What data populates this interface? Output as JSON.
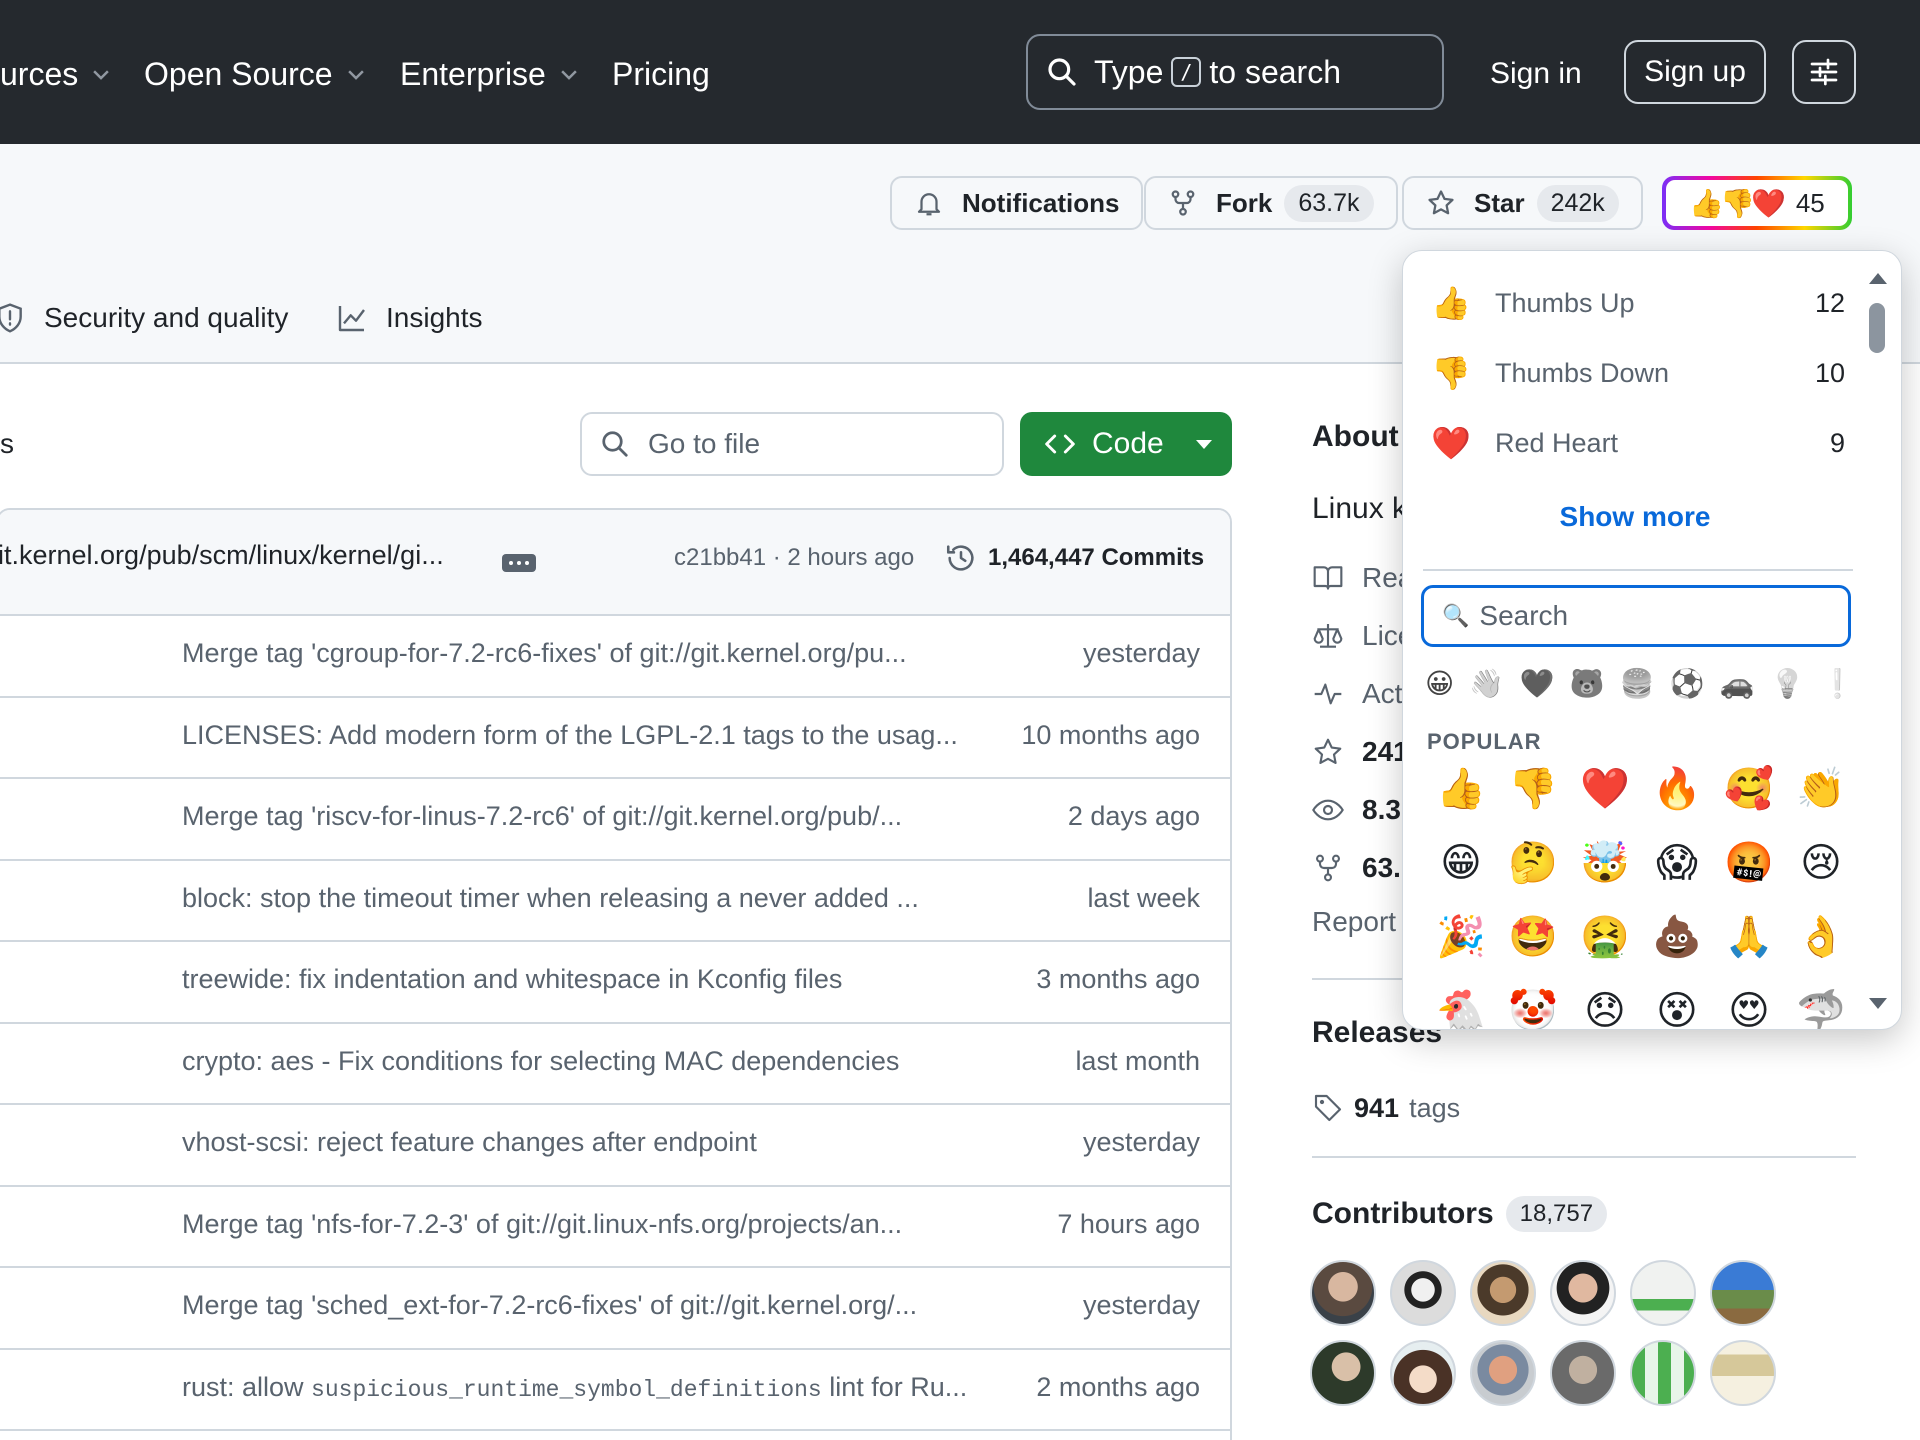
{
  "nav": {
    "items": [
      "urces",
      "Open Source",
      "Enterprise",
      "Pricing"
    ],
    "search_pre": "Type",
    "search_key": "/",
    "search_post": "to search",
    "signin": "Sign in",
    "signup": "Sign up"
  },
  "header": {
    "notifications": "Notifications",
    "fork_label": "Fork",
    "fork_count": "63.7k",
    "star_label": "Star",
    "star_count": "242k",
    "reactions_emoji": "👍👎❤️",
    "reactions_count": "45"
  },
  "tabs": {
    "security": "Security and quality",
    "insights": "Insights"
  },
  "files": {
    "side_fragment": "s",
    "goto_placeholder": "Go to file",
    "code_label": "Code",
    "latest_message": "it.kernel.org/pub/scm/linux/kernel/gi...",
    "latest_hash": "c21bb41 · 2 hours ago",
    "commit_count": "1,464,447 Commits",
    "rows": [
      {
        "msg": "Merge tag 'cgroup-for-7.2-rc6-fixes' of git://git.kernel.org/pu...",
        "time": "yesterday"
      },
      {
        "msg": "LICENSES: Add modern form of the LGPL-2.1 tags to the usag...",
        "time": "10 months ago"
      },
      {
        "msg": "Merge tag 'riscv-for-linus-7.2-rc6' of git://git.kernel.org/pub/...",
        "time": "2 days ago"
      },
      {
        "msg": "block: stop the timeout timer when releasing a never added ...",
        "time": "last week"
      },
      {
        "msg": "treewide: fix indentation and whitespace in Kconfig files",
        "time": "3 months ago"
      },
      {
        "msg": "crypto: aes - Fix conditions for selecting MAC dependencies",
        "time": "last month"
      },
      {
        "msg": "vhost-scsi: reject feature changes after endpoint",
        "time": "yesterday"
      },
      {
        "msg": "Merge tag 'nfs-for-7.2-3' of git://git.linux-nfs.org/projects/an...",
        "time": "7 hours ago"
      },
      {
        "msg": "Merge tag 'sched_ext-for-7.2-rc6-fixes' of git://git.kernel.org/...",
        "time": "yesterday"
      },
      {
        "msg_pre": "rust: allow ",
        "msg_code": "suspicious_runtime_symbol_definitions",
        "msg_post": " lint for Ru...",
        "time": "2 months ago"
      }
    ]
  },
  "sidebar": {
    "about": "About",
    "desc": "Linux k",
    "readme": "Rea",
    "license": "Lice",
    "activity": "Act",
    "stars": "241",
    "watchers": "8.3",
    "forks": "63.",
    "report": "Report",
    "releases": "Releases",
    "tags_count": "941",
    "tags_label": "tags",
    "contributors": "Contributors",
    "contributors_count": "18,757"
  },
  "popover": {
    "reactions": [
      {
        "emoji": "👍",
        "name": "Thumbs Up",
        "count": "12"
      },
      {
        "emoji": "👎",
        "name": "Thumbs Down",
        "count": "10"
      },
      {
        "emoji": "❤️",
        "name": "Red Heart",
        "count": "9"
      }
    ],
    "show_more": "Show more",
    "search_placeholder": "Search",
    "search_icon": "🔍",
    "categories": [
      "😀",
      "👋",
      "🖤",
      "🐻",
      "🍔",
      "⚽",
      "🚗",
      "💡",
      "❕"
    ],
    "popular_label": "POPULAR",
    "popular": [
      "👍",
      "👎",
      "❤️",
      "🔥",
      "🥰",
      "👏",
      "😁",
      "🤔",
      "🤯",
      "😱",
      "🤬",
      "😢",
      "🎉",
      "🤩",
      "🤮",
      "💩",
      "🙏",
      "👌",
      "🐔",
      "🤡",
      "😞",
      "😵",
      "😍",
      "🦈"
    ]
  },
  "colors": {
    "nav_bg": "#25292e",
    "code_button": "#1f883d",
    "link": "#0969da"
  }
}
